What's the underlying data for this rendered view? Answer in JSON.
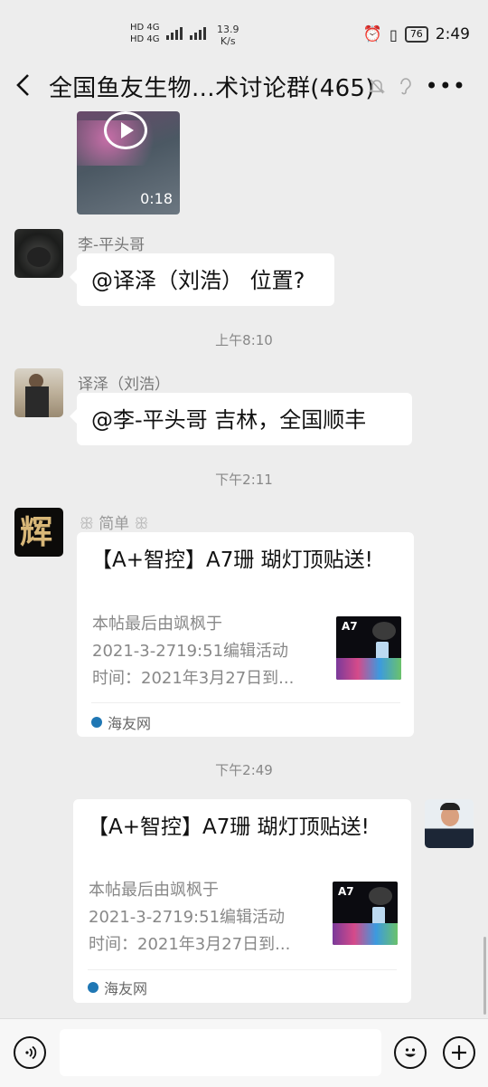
{
  "status_bar": {
    "network_top": "HD 4G",
    "network_bottom": "HD 4G",
    "speed_value": "13.9",
    "speed_unit": "K/s",
    "battery": "76",
    "time": "2:49"
  },
  "nav": {
    "back_icon": "chevron-left-icon",
    "title": "全国鱼友生物…术讨论群(465)",
    "mute_icon": "bell-off-icon",
    "ear_icon": "ear-icon",
    "more_icon": "more-icon"
  },
  "video": {
    "duration": "0:18"
  },
  "messages": [
    {
      "sender": "李-平头哥",
      "text": "@译泽（刘浩） 位置?"
    },
    {
      "sender": "译泽（刘浩）",
      "text": "@李-平头哥  吉林，全国顺丰"
    }
  ],
  "times": [
    "上午8:10",
    "下午2:11",
    "下午2:49"
  ],
  "card_sender": "简单",
  "cards": [
    {
      "title": "【A+智控】A7珊 瑚灯顶贴送!",
      "desc_line1": "本帖最后由飒枫于",
      "desc_line2": "2021-3-2719:51编辑活动",
      "desc_line3": "时间：2021年3月27日到...",
      "thumb_label": "A7",
      "source": "海友网"
    },
    {
      "title": "【A+智控】A7珊 瑚灯顶贴送!",
      "desc_line1": "本帖最后由飒枫于",
      "desc_line2": "2021-3-2719:51编辑活动",
      "desc_line3": "时间：2021年3月27日到...",
      "thumb_label": "A7",
      "source": "海友网"
    }
  ],
  "input_bar": {
    "voice_icon": "voice-icon",
    "emoji_icon": "emoji-icon",
    "plus_icon": "plus-icon",
    "placeholder": ""
  }
}
